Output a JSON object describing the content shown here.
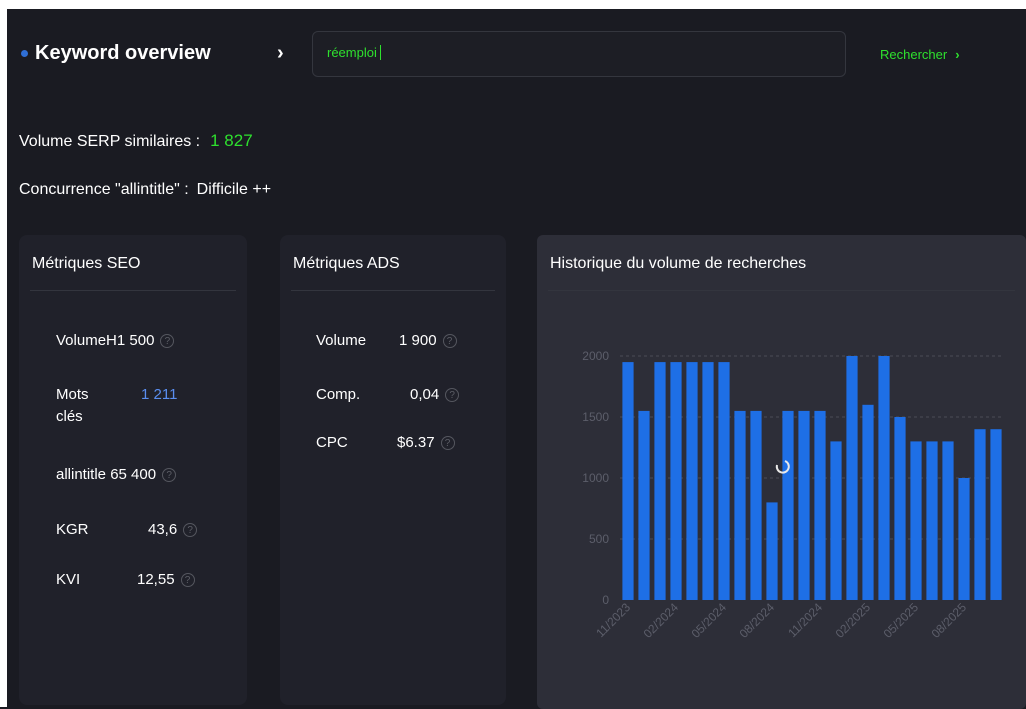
{
  "header": {
    "title": "Keyword overview",
    "chevron": "›",
    "search_value": "réemploi",
    "search_button": "Rechercher",
    "search_button_arrow": "›"
  },
  "stats": {
    "serp_label": "Volume SERP similaires :",
    "serp_value": "1 827",
    "competition_label": "Concurrence \"allintitle\" :",
    "competition_value": "Difficile ++"
  },
  "seo": {
    "title": "Métriques SEO",
    "volume_label": "VolumeH",
    "volume_value": "1 500",
    "mots_label_1": "Mots",
    "mots_label_2": "clés",
    "mots_value": "1 211",
    "allintitle_label": "allintitle",
    "allintitle_value": "65 400",
    "kgr_label": "KGR",
    "kgr_value": "43,6",
    "kvi_label": "KVI",
    "kvi_value": "12,55"
  },
  "ads": {
    "title": "Métriques ADS",
    "volume_label": "Volume",
    "volume_value": "1 900",
    "comp_label": "Comp.",
    "comp_value": "0,04",
    "cpc_label": "CPC",
    "cpc_value": "$6.37"
  },
  "info_glyph": "?",
  "colors": {
    "accent_green": "#2ee02e",
    "bar_blue": "#1e6fe6",
    "link_blue": "#5a8ef0"
  },
  "chart_data": {
    "type": "bar",
    "title": "Historique du volume de recherches",
    "ylim": [
      0,
      2000
    ],
    "yticks": [
      0,
      500,
      1000,
      1500,
      2000
    ],
    "xtick_labels": [
      "11/2023",
      "02/2024",
      "05/2024",
      "08/2024",
      "11/2024",
      "02/2025",
      "05/2025",
      "08/2025"
    ],
    "values": [
      1950,
      1550,
      1950,
      1950,
      1950,
      1950,
      1950,
      1550,
      1550,
      800,
      1550,
      1550,
      1550,
      1300,
      2000,
      1600,
      2000,
      1500,
      1300,
      1300,
      1300,
      1000,
      1400,
      1400
    ],
    "grid": true
  }
}
